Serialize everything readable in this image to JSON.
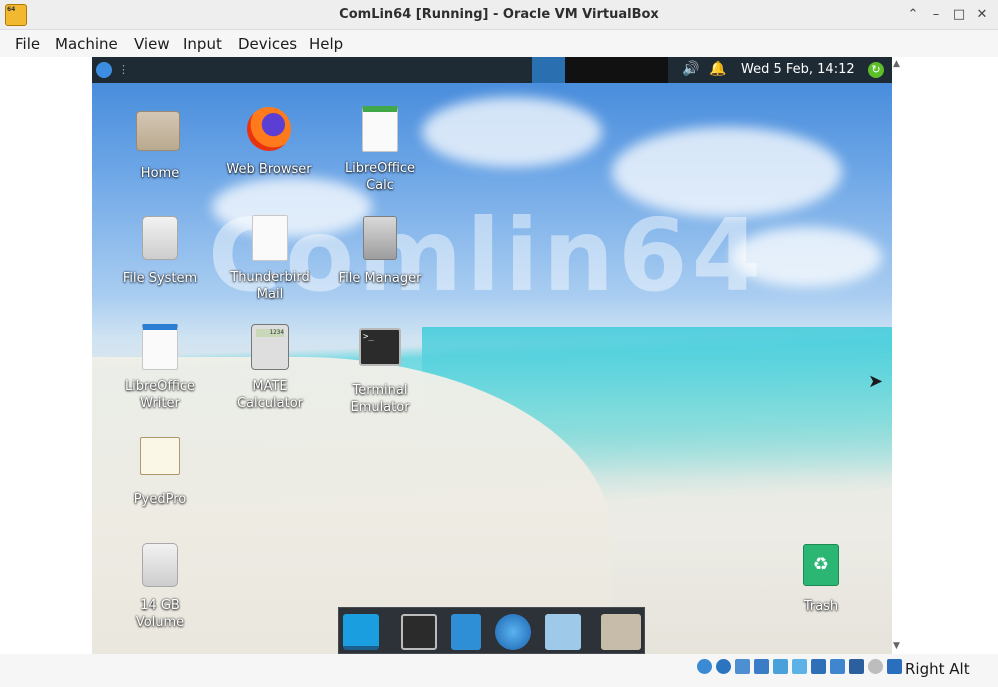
{
  "window": {
    "title": "ComLin64 [Running] - Oracle VM VirtualBox",
    "app_icon_text": "64",
    "controls": {
      "minimize_up": "⌃",
      "minimize": "–",
      "maximize": "□",
      "close": "✕"
    }
  },
  "menubar": {
    "items": [
      "File",
      "Machine",
      "View",
      "Input",
      "Devices",
      "Help"
    ]
  },
  "guest": {
    "watermark": "Comlin64",
    "panel": {
      "separator": "⋮",
      "volume_icon": "🔊",
      "bell_icon": "🔔",
      "clock": "Wed  5 Feb, 14:12",
      "update_icon": "↻"
    },
    "desktop_icons": [
      {
        "label": "Home",
        "icon": "home-folder-icon"
      },
      {
        "label": "Web Browser",
        "icon": "firefox-icon"
      },
      {
        "label": "LibreOffice Calc",
        "icon": "spreadsheet-icon"
      },
      {
        "label": "File System",
        "icon": "hard-drive-icon"
      },
      {
        "label": "Thunderbird Mail",
        "icon": "document-icon"
      },
      {
        "label": "File Manager",
        "icon": "filing-cabinet-icon"
      },
      {
        "label": "LibreOffice Writer",
        "icon": "writer-document-icon"
      },
      {
        "label": "MATE Calculator",
        "icon": "calculator-icon"
      },
      {
        "label": "Terminal Emulator",
        "icon": "terminal-icon"
      },
      {
        "label": "PyedPro",
        "icon": "notepad-pencil-icon"
      },
      {
        "label": "14 GB Volume",
        "icon": "removable-drive-icon"
      },
      {
        "label": "Trash",
        "icon": "trash-icon"
      }
    ],
    "terminal_prompt": ">_",
    "calc_display": "1234",
    "dock": [
      "show-desktop",
      "terminal",
      "file-manager",
      "web-browser",
      "search",
      "folder"
    ]
  },
  "statusbar": {
    "host_key": "Right Alt"
  },
  "colors": {
    "panel_bg": "#1e2a34",
    "dock_bg": "#2c3238",
    "accent_blue": "#2f8fd6"
  }
}
